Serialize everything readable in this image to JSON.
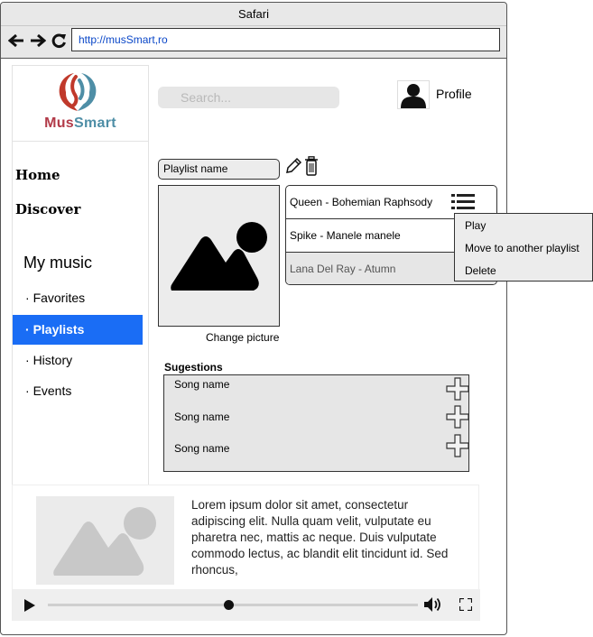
{
  "browser": {
    "title": "Safari",
    "url": "http://musSmart,ro"
  },
  "logo": {
    "part1": "Mus",
    "part2": "Smart"
  },
  "nav": {
    "home": "Home",
    "discover": "Discover",
    "my_music": "My music",
    "items": [
      {
        "label": "Favorites",
        "active": false
      },
      {
        "label": "Playlists",
        "active": true
      },
      {
        "label": "History",
        "active": false
      },
      {
        "label": "Events",
        "active": false
      }
    ]
  },
  "header": {
    "search_placeholder": "Search...",
    "profile_label": "Profile"
  },
  "playlist": {
    "name_placeholder": "Playlist name",
    "change_picture": "Change picture",
    "songs": [
      "Queen - Bohemian Raphsody",
      "Spike - Manele manele",
      "Lana Del Ray - Atumn"
    ],
    "context_menu": [
      "Play",
      "Move to another playlist",
      "Delete"
    ]
  },
  "suggestions": {
    "title": "Sugestions",
    "items": [
      "Song name",
      "Song name",
      "Song name"
    ]
  },
  "player": {
    "description": "Lorem ipsum dolor sit amet, consectetur adipiscing elit. Nulla quam velit, vulputate eu pharetra nec, mattis ac neque. Duis vulputate commodo lectus, ac blandit elit tincidunt id. Sed rhoncus,",
    "progress": 0.49
  },
  "colors": {
    "accent": "#1a6df5",
    "logo_red": "#b23a48",
    "logo_blue": "#4e8ea6"
  }
}
